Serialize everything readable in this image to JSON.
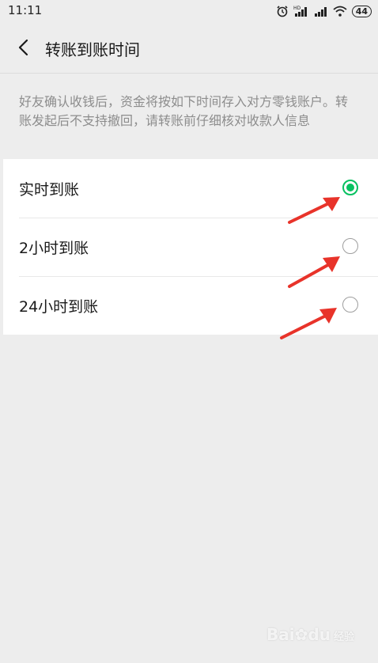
{
  "status_bar": {
    "time": "11:11",
    "battery": "44",
    "icons": [
      "alarm-icon",
      "hd-signal-icon",
      "signal-icon",
      "wifi-icon",
      "battery-icon"
    ]
  },
  "header": {
    "back_icon": "chevron-left-icon",
    "title": "转账到账时间"
  },
  "description": "好友确认收钱后，资金将按如下时间存入对方零钱账户。转账发起后不支持撤回，请转账前仔细核对收款人信息",
  "options": [
    {
      "label": "实时到账",
      "selected": true
    },
    {
      "label": "2小时到账",
      "selected": false
    },
    {
      "label": "24小时到账",
      "selected": false
    }
  ],
  "colors": {
    "accent": "#07c160",
    "annotation_arrow": "#e8332a",
    "background": "#ededed"
  },
  "watermark": {
    "brand": "Bai",
    "brand_tail": "du",
    "sub": "经验"
  }
}
